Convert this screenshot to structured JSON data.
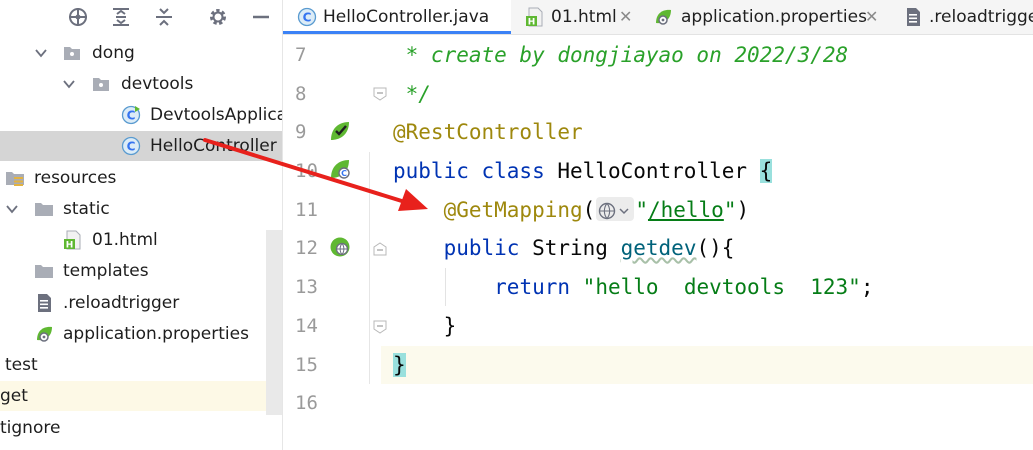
{
  "project_tree": {
    "rows": [
      {
        "label": "dong"
      },
      {
        "label": "devtools"
      },
      {
        "label": "DevtoolsApplicat"
      },
      {
        "label": "HelloController"
      },
      {
        "label": "resources"
      },
      {
        "label": "static"
      },
      {
        "label": "01.html"
      },
      {
        "label": "templates"
      },
      {
        "label": ".reloadtrigger"
      },
      {
        "label": "application.properties"
      },
      {
        "label": "test"
      },
      {
        "label": "get"
      },
      {
        "label": "tignore"
      }
    ]
  },
  "tabs": [
    {
      "label": "HelloController.java",
      "active": true
    },
    {
      "label": "01.html",
      "active": false
    },
    {
      "label": "application.properties",
      "active": false
    },
    {
      "label": ".reloadtrigge",
      "active": false
    }
  ],
  "editor": {
    "line_numbers": [
      "7",
      "8",
      "9",
      "10",
      "11",
      "12",
      "13",
      "14",
      "15",
      "16"
    ],
    "lines": {
      "l7": " * create by dongjiayao on 2022/3/28",
      "l8": " */",
      "l9_ann": "@RestController",
      "l10_kw": "public class ",
      "l10_name": "HelloController ",
      "l10_brace": "{",
      "l11_ann": "@GetMapping",
      "l11_open": "(",
      "l11_str_q1": "\"",
      "l11_str_path": "/hello",
      "l11_str_q2": "\"",
      "l11_close": ")",
      "l12_kw": "public ",
      "l12_type": "String ",
      "l12_method": "getdev",
      "l12_rest": "(){",
      "l13_kw": "return ",
      "l13_str": "\"hello  devtools  123\"",
      "l13_end": ";",
      "l14": "}",
      "l15": "}"
    }
  },
  "colors": {
    "accent": "#3b82f6",
    "arrow": "#e8211c",
    "spring_green": "#5fb832"
  }
}
